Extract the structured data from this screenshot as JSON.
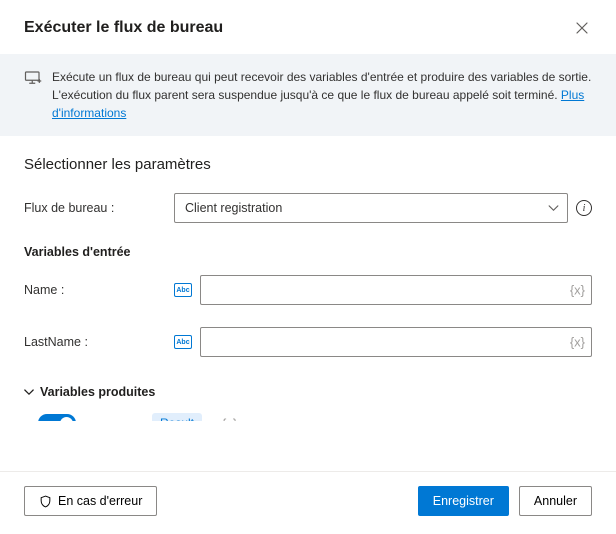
{
  "header": {
    "title": "Exécuter le flux de bureau"
  },
  "banner": {
    "text": "Exécute un flux de bureau qui peut recevoir des variables d'entrée et produire des variables de sortie. L'exécution du flux parent sera suspendue jusqu'à ce que le flux de bureau appelé soit terminé. ",
    "link_label": "Plus d'informations"
  },
  "section": {
    "title": "Sélectionner les paramètres",
    "flow_label": "Flux de bureau :",
    "flow_selected": "Client registration",
    "inputs_title": "Variables d'entrée",
    "inputs": [
      {
        "label": "Name :",
        "type": "Abc",
        "value": ""
      },
      {
        "label": "LastName :",
        "type": "Abc",
        "value": ""
      }
    ],
    "produced_title": "Variables produites",
    "produced_var": "Result"
  },
  "footer": {
    "error_label": "En cas d'erreur",
    "save_label": "Enregistrer",
    "cancel_label": "Annuler"
  }
}
